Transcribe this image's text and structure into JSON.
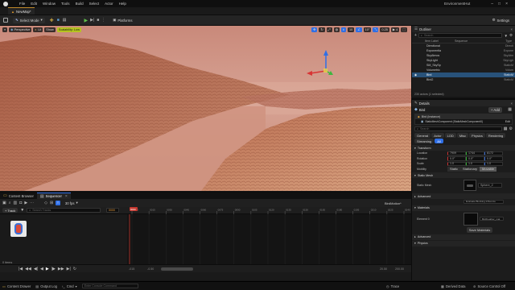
{
  "menubar": {
    "project": "NewMap*",
    "items": [
      "File",
      "Edit",
      "Window",
      "Tools",
      "Build",
      "Select",
      "Actor",
      "Help"
    ],
    "app_name": "EnvironmentHut"
  },
  "toolbar": {
    "select_mode": "Select Mode",
    "platforms": "Platforms",
    "settings": "Settings"
  },
  "viewport": {
    "perspective": "Perspective",
    "lit": "Lit",
    "show": "Show",
    "scalability": "Scalability: Low",
    "snap_angle": "10",
    "snap_scale": "10°",
    "snap_value": "0.25",
    "camera_speed": "4"
  },
  "outliner": {
    "title": "Outliner",
    "close": "×",
    "search_placeholder": "Search",
    "col_label": "Item Label",
    "col_type": "Type",
    "col_sequence": "Sequence",
    "rows": [
      {
        "label": "Directional",
        "type": "Directi"
      },
      {
        "label": "Exponentia",
        "type": "Expone"
      },
      {
        "label": "SkyAtmos",
        "type": "SkyAtm"
      },
      {
        "label": "SkyLight",
        "type": "SkyLigh"
      },
      {
        "label": "SM_SkySp",
        "type": "StaticM"
      },
      {
        "label": "Volumetric",
        "type": "Volum"
      },
      {
        "label": "Bird",
        "type": "StaticM",
        "selected": true
      },
      {
        "label": "Bird2",
        "type": "StaticM"
      }
    ],
    "footer": "230 actors (1 selected)"
  },
  "details": {
    "title": "Details",
    "close": "×",
    "actor_name": "Bird",
    "add_button": "+ Add",
    "instance": "Bird (Instance)",
    "component": "StaticMeshComponent (StaticMeshComponent0)",
    "edit": "Edit",
    "search_placeholder": "Search",
    "filters": [
      "General",
      "Actor",
      "LOD",
      "Misc",
      "Physics",
      "Rendering",
      "Streaming",
      "All"
    ],
    "transform_label": "Transform",
    "location_label": "Location",
    "location": [
      "7909",
      "1744",
      "8172"
    ],
    "rotation_label": "Rotation",
    "rotation": [
      "0.0°",
      "0.0°",
      "0.0°"
    ],
    "scale_label": "Scale",
    "scale": [
      "1.0",
      "1.0",
      "1.0"
    ],
    "mobility_label": "Mobility",
    "mobility": [
      "Static",
      "Stationary",
      "Movable"
    ],
    "static_mesh_section": "Static Mesh",
    "static_mesh_label": "Static Mesh",
    "static_mesh_value": "Sphere_2",
    "advanced": "Advanced",
    "evaluate_option": "Evaluate Blocking Influence",
    "materials_section": "Materials",
    "element_label": "Element 0",
    "material_value": "BirdFeather_mat",
    "save_materials": "Save Materials",
    "physics_section": "Physics"
  },
  "sequencer": {
    "tab_content_browser": "Content Browser",
    "tab_sequencer": "Sequencer",
    "add_track": "+ Track",
    "search_placeholder": "Search Tracks",
    "current_frame": "0000",
    "fps": "30 fps",
    "sequence_name": "BirdMotion*",
    "ruler_ticks": [
      "0000",
      "0015",
      "0030",
      "0045",
      "0060",
      "0075",
      "0090",
      "0105",
      "0120",
      "0135",
      "0150",
      "0165",
      "0180",
      "0195",
      "0210",
      "0225",
      "0240"
    ],
    "playhead": "0000",
    "items_count": "0 items",
    "range_start": "-015",
    "range_start2": "-0.50",
    "range_end": "20.50",
    "range_end2": "200.00"
  },
  "statusbar": {
    "content_drawer": "Content Drawer",
    "output_log": "Output Log",
    "cmd": "Cmd",
    "console_placeholder": "Enter Console Command",
    "trace": "Trace",
    "derived_data": "Derived Data",
    "source_control": "Source Control Off"
  }
}
